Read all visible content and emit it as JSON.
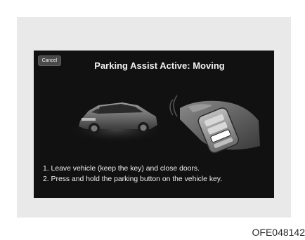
{
  "dialog": {
    "cancel_label": "Cancel",
    "title": "Parking Assist Active: Moving",
    "instructions": [
      "1. Leave vehicle (keep the key) and close doors.",
      "2. Press and hold the parking button on the vehicle key."
    ]
  },
  "figure_code": "OFE048142",
  "icons": {
    "illustration": "car-and-remote-key-illustration"
  },
  "colors": {
    "screen_bg": "#111111",
    "text": "#f1f1f1",
    "frame_bg": "#e9e9ea"
  }
}
